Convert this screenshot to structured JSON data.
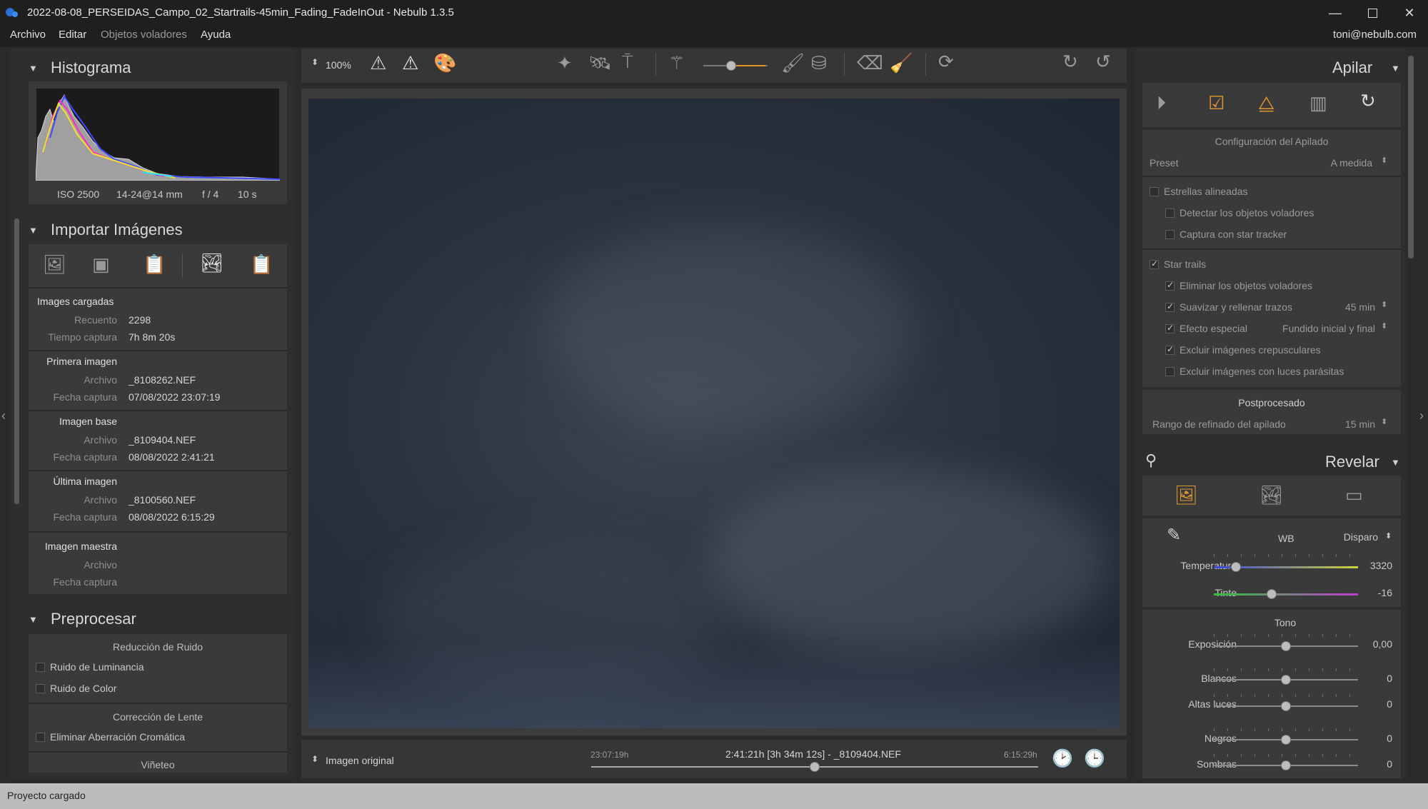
{
  "window": {
    "title": "2022-08-08_PERSEIDAS_Campo_02_Startrails-45min_Fading_FadeInOut - Nebulb 1.3.5",
    "controls": [
      "minimize",
      "maximize",
      "close"
    ]
  },
  "menu": {
    "items": [
      "Archivo",
      "Editar",
      "Objetos voladores",
      "Ayuda"
    ],
    "user": "toni@nebulb.com"
  },
  "histogram": {
    "title": "Histograma",
    "iso": "ISO 2500",
    "lens": "14-24@14 mm",
    "aperture": "f / 4",
    "exposure": "10 s"
  },
  "import": {
    "title": "Importar Imágenes",
    "loaded": {
      "heading": "Images cargadas",
      "count_label": "Recuento",
      "count": "2298",
      "time_label": "Tiempo captura",
      "time": "7h 8m 20s"
    },
    "first": {
      "heading": "Primera imagen",
      "file_label": "Archivo",
      "file": "_8108262.NEF",
      "date_label": "Fecha captura",
      "date": "07/08/2022 23:07:19"
    },
    "base": {
      "heading": "Imagen base",
      "file_label": "Archivo",
      "file": "_8109404.NEF",
      "date_label": "Fecha captura",
      "date": "08/08/2022 2:41:21"
    },
    "last": {
      "heading": "Última imagen",
      "file_label": "Archivo",
      "file": "_8100560.NEF",
      "date_label": "Fecha captura",
      "date": "08/08/2022 6:15:29"
    },
    "master": {
      "heading": "Imagen maestra",
      "file_label": "Archivo",
      "date_label": "Fecha captura"
    }
  },
  "preprocess": {
    "title": "Preprocesar",
    "noise": {
      "heading": "Reducción de Ruido",
      "luminance": "Ruido de Luminancia",
      "color": "Ruido de Color"
    },
    "lens": {
      "heading": "Corrección de Lente",
      "chromatic": "Eliminar Aberración Cromática"
    },
    "vignette": "Viñeteo"
  },
  "toolbar": {
    "zoom": "100%"
  },
  "bottombar": {
    "mode": "Imagen original",
    "start_time": "23:07:19h",
    "current": "2:41:21h [3h 34m 12s] - _8109404.NEF",
    "end_time": "6:15:29h",
    "timeline_position": 0.5
  },
  "stack": {
    "title": "Apilar",
    "config_heading": "Configuración del Apilado",
    "preset_label": "Preset",
    "preset_value": "A medida",
    "aligned": "Estrellas alineadas",
    "detect_flying": "Detectar los objetos voladores",
    "star_tracker": "Captura con star tracker",
    "star_trails": "Star trails",
    "remove_flying": "Eliminar los objetos voladores",
    "smooth_fill": "Suavizar y rellenar trazos",
    "smooth_value": "45 min",
    "special_effect": "Efecto especial",
    "special_value": "Fundido inicial y final",
    "exclude_twilight": "Excluir imágenes crepusculares",
    "exclude_lights": "Excluir imágenes con luces parásitas",
    "post_heading": "Postprocesado",
    "refine_label": "Rango de refinado del apilado",
    "refine_value": "15 min"
  },
  "develop": {
    "title": "Revelar",
    "wb_label": "WB",
    "wb_value": "Disparo",
    "temperature_label": "Temperatura",
    "temperature": "3320",
    "tint_label": "Tinte",
    "tint": "-16",
    "tone_heading": "Tono",
    "exposure_label": "Exposición",
    "exposure": "0,00",
    "whites_label": "Blancos",
    "whites": "0",
    "highlights_label": "Altas luces",
    "highlights": "0",
    "blacks_label": "Negros",
    "blacks": "0",
    "shadows_label": "Sombras",
    "shadows": "0"
  },
  "status": {
    "text": "Proyecto cargado"
  },
  "colors": {
    "accent": "#e0982c",
    "panel": "#3a3a3a",
    "background": "#2b2b2b"
  }
}
